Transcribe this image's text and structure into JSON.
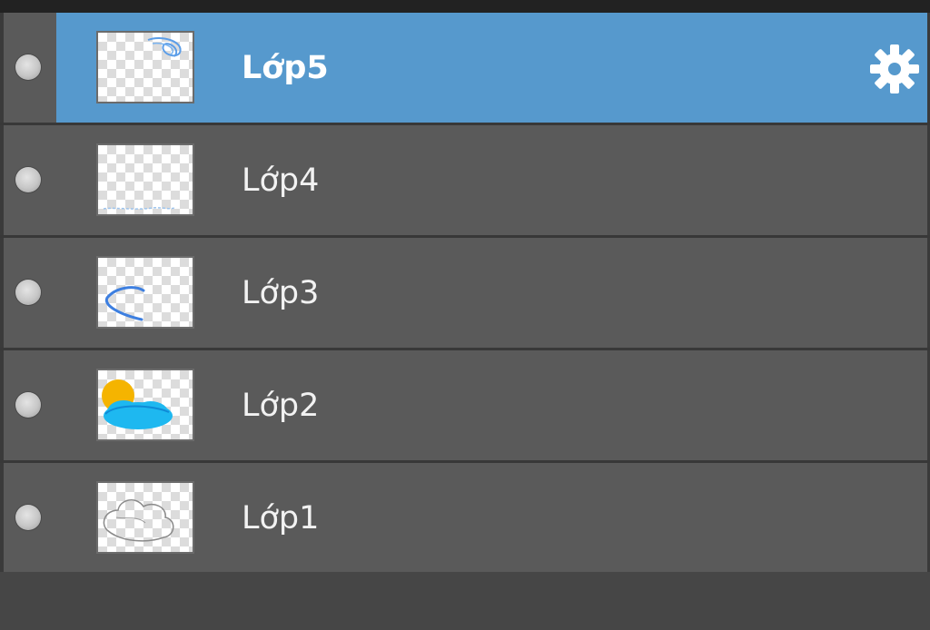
{
  "layers_panel": {
    "layers": [
      {
        "name": "Lớp5",
        "selected": true,
        "visible": true,
        "thumbnail": "blue-scribble-top-right"
      },
      {
        "name": "Lớp4",
        "selected": false,
        "visible": true,
        "thumbnail": "faint-blue-line-bottom"
      },
      {
        "name": "Lớp3",
        "selected": false,
        "visible": true,
        "thumbnail": "blue-arc-left"
      },
      {
        "name": "Lớp2",
        "selected": false,
        "visible": true,
        "thumbnail": "sun-and-cloud-colored"
      },
      {
        "name": "Lớp1",
        "selected": false,
        "visible": true,
        "thumbnail": "cloud-outline"
      }
    ],
    "settings_icon": "gear-icon"
  },
  "colors": {
    "selected_row": "#5699cd",
    "row": "#5a5a5a",
    "panel_bg": "#464646"
  }
}
